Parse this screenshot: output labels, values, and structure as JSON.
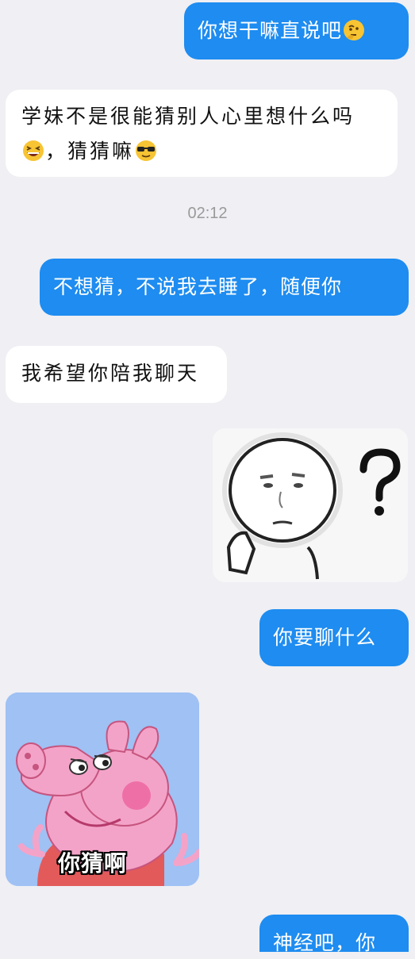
{
  "messages": [
    {
      "text": "你想干嘛直说吧",
      "emoji": "thinking-face-icon"
    },
    {
      "line1": "学妹不是很能猜别人心里想什么吗",
      "line2": "，猜猜嘛",
      "emoji_start": "grinning-squint-face-icon",
      "emoji_end": "sunglasses-face-icon"
    },
    {
      "text": "不想猜，不说我去睡了，随便你"
    },
    {
      "text": "我希望你陪我聊天"
    },
    {
      "sticker": "confused-face-question-sticker"
    },
    {
      "text": "你要聊什么"
    },
    {
      "sticker": "peppa-pig-sticker",
      "caption": "你猜啊"
    },
    {
      "text": "神经吧，你"
    }
  ],
  "timestamp": "02:12",
  "colors": {
    "outgoing_bubble": "#1e8cf0",
    "incoming_bubble": "#ffffff",
    "background": "#efeff4",
    "timestamp": "#9a9a9a"
  }
}
